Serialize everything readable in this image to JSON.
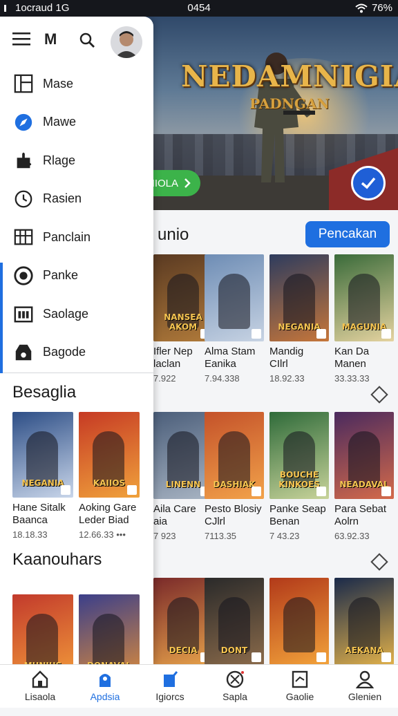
{
  "status": {
    "left": "1ocraud 1G",
    "time": "0454",
    "battery": "76%"
  },
  "drawer": {
    "logo_letter": "M",
    "menu": [
      {
        "label": "Mase",
        "icon": "layout-icon"
      },
      {
        "label": "Mawe",
        "icon": "compass-icon"
      },
      {
        "label": "Rlage",
        "icon": "puzzle-icon"
      },
      {
        "label": "Rasien",
        "icon": "clock-icon"
      },
      {
        "label": "Panclain",
        "icon": "grid-icon"
      },
      {
        "label": "Panke",
        "icon": "record-icon"
      },
      {
        "label": "Saolage",
        "icon": "calendar-icon"
      },
      {
        "label": "Bagode",
        "icon": "bag-icon"
      }
    ],
    "section1": "Besaglia",
    "section1_cards": [
      {
        "name": "Hane Sitalk",
        "name2": "Baanca",
        "meta": "18.18.33",
        "cover_title": "NEGANIA",
        "colors": [
          "#2d4e86",
          "#c9d6ea"
        ]
      },
      {
        "name": "Aoking Gare",
        "name2": "Leder Biad",
        "meta": "12.66.33",
        "cover_title": "KAIIOS",
        "colors": [
          "#c63a24",
          "#f0a23c"
        ]
      }
    ],
    "section2": "Kaanouhars",
    "section2_cards": [
      {
        "colors": [
          "#c23a2c",
          "#f29b3a"
        ],
        "cover_title": "MUNIUS"
      },
      {
        "colors": [
          "#3b3f8a",
          "#d98a3c"
        ],
        "cover_title": "DONAVAL"
      }
    ]
  },
  "hero": {
    "title": "NEDAMNIGIA",
    "subtitle": "PADNGAN",
    "button": "NIOLA"
  },
  "main": {
    "section1_title": "unio",
    "action_button": "Pencakan",
    "row1": [
      {
        "name": "Ifler Nep",
        "name2": "laclan",
        "meta": "7.922",
        "cover_title": "NANSEA AKOM",
        "colors": [
          "#5a3a22",
          "#b07a3a"
        ]
      },
      {
        "name": "Alma Stam",
        "name2": "Eanika",
        "meta": "7.94.338",
        "cover_title": "",
        "colors": [
          "#6e8db5",
          "#c7d3e3"
        ]
      },
      {
        "name": "Mandig",
        "name2": "CIlrl",
        "meta": "18.92.33",
        "cover_title": "NEGANIA",
        "colors": [
          "#2e3c5e",
          "#c6763a"
        ]
      },
      {
        "name": "Kan Da",
        "name2": "Manen",
        "meta": "33.33.33",
        "cover_title": "MAGUNIA",
        "colors": [
          "#3a6b3a",
          "#e5d3a0"
        ]
      }
    ],
    "row2": [
      {
        "name": "Aila Care",
        "name2": "aia",
        "meta": "7 923",
        "cover_title": "LINENN",
        "colors": [
          "#4b5e7a",
          "#a8b4c3"
        ]
      },
      {
        "name": "Pesto Blosiy",
        "name2": "CJlrl",
        "meta": "7113.35",
        "cover_title": "DASHIAK",
        "colors": [
          "#c4522a",
          "#f2a24a"
        ]
      },
      {
        "name": "Panke Seap",
        "name2": "Benan",
        "meta": "7 43.23",
        "cover_title": "BOUCHE KINKOES",
        "colors": [
          "#2f6b3a",
          "#c8d39a"
        ]
      },
      {
        "name": "Para Sebat",
        "name2": "Aolrn",
        "meta": "63.92.33",
        "cover_title": "NEADAVAL",
        "colors": [
          "#4a2a5e",
          "#d46a4a"
        ]
      }
    ],
    "row3": [
      {
        "cover_title": "DECIA",
        "colors": [
          "#7a2a2a",
          "#e5a04a"
        ]
      },
      {
        "cover_title": "DONT",
        "colors": [
          "#2a2a2a",
          "#8a6a4a"
        ]
      },
      {
        "cover_title": "",
        "colors": [
          "#b23a1a",
          "#f2a23a"
        ]
      },
      {
        "cover_title": "AEKANA",
        "colors": [
          "#1a2a4a",
          "#e0b04a"
        ]
      }
    ]
  },
  "bottom_nav": [
    {
      "label": "Lisaola",
      "icon": "home-icon"
    },
    {
      "label": "Apdsia",
      "icon": "tag-icon",
      "active": true
    },
    {
      "label": "Igiorcs",
      "icon": "edit-icon"
    },
    {
      "label": "Sapla",
      "icon": "compass-icon"
    },
    {
      "label": "Gaolie",
      "icon": "board-icon"
    },
    {
      "label": "Glenien",
      "icon": "person-icon"
    }
  ]
}
